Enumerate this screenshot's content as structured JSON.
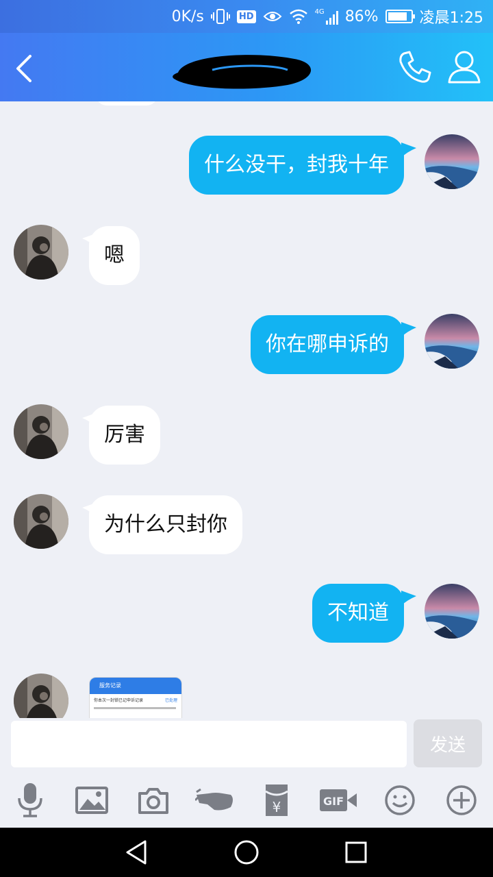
{
  "status": {
    "speed": "0K/s",
    "hd": "HD",
    "network": "4G",
    "battery": "86%",
    "battery_level": 0.86,
    "time": "凌晨1:25"
  },
  "header": {
    "back_icon": "chevron-left-icon",
    "call_icon": "phone-icon",
    "profile_icon": "user-icon"
  },
  "messages": [
    {
      "side": "out",
      "text": "什么没干，封我十年"
    },
    {
      "side": "in",
      "text": "嗯"
    },
    {
      "side": "out",
      "text": "你在哪申诉的"
    },
    {
      "side": "in",
      "text": "厉害"
    },
    {
      "side": "in",
      "text": "为什么只封你"
    },
    {
      "side": "out",
      "text": "不知道"
    }
  ],
  "thumbnail": {
    "title": "服务记录",
    "line1": "你本次一封锁已记申诉记录",
    "tag": "已处理"
  },
  "input": {
    "value": "",
    "send_label": "发送"
  },
  "toolbar": {
    "gif_label": "GIF",
    "yen_label": "¥",
    "icons": [
      "microphone-icon",
      "image-icon",
      "camera-icon",
      "poke-hand-icon",
      "red-packet-icon",
      "gif-icon",
      "emoji-icon",
      "plus-icon"
    ]
  },
  "colors": {
    "outgoing_bubble": "#12b3f2",
    "incoming_bubble": "#ffffff",
    "background": "#eef0f6",
    "header_start": "#4479f2",
    "header_end": "#22c1f8"
  }
}
